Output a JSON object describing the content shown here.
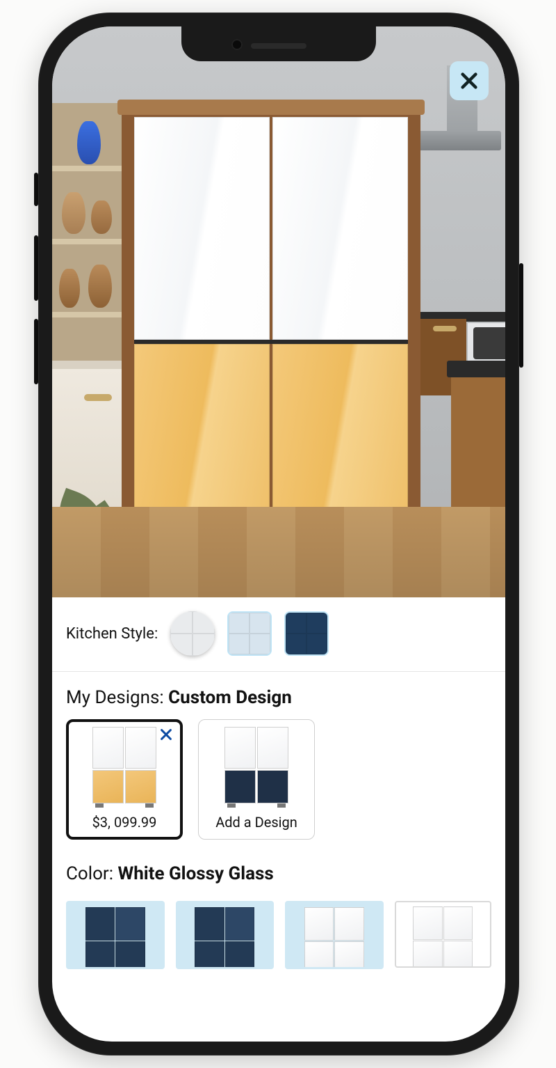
{
  "close_label": "✕",
  "kitchen_style": {
    "label": "Kitchen Style:"
  },
  "my_designs": {
    "prefix": "My Designs: ",
    "name": "Custom Design",
    "items": [
      {
        "caption": "$3, 099.99"
      },
      {
        "caption": "Add a Design"
      }
    ]
  },
  "color_picker": {
    "prefix": "Color: ",
    "name": "White Glossy Glass"
  }
}
